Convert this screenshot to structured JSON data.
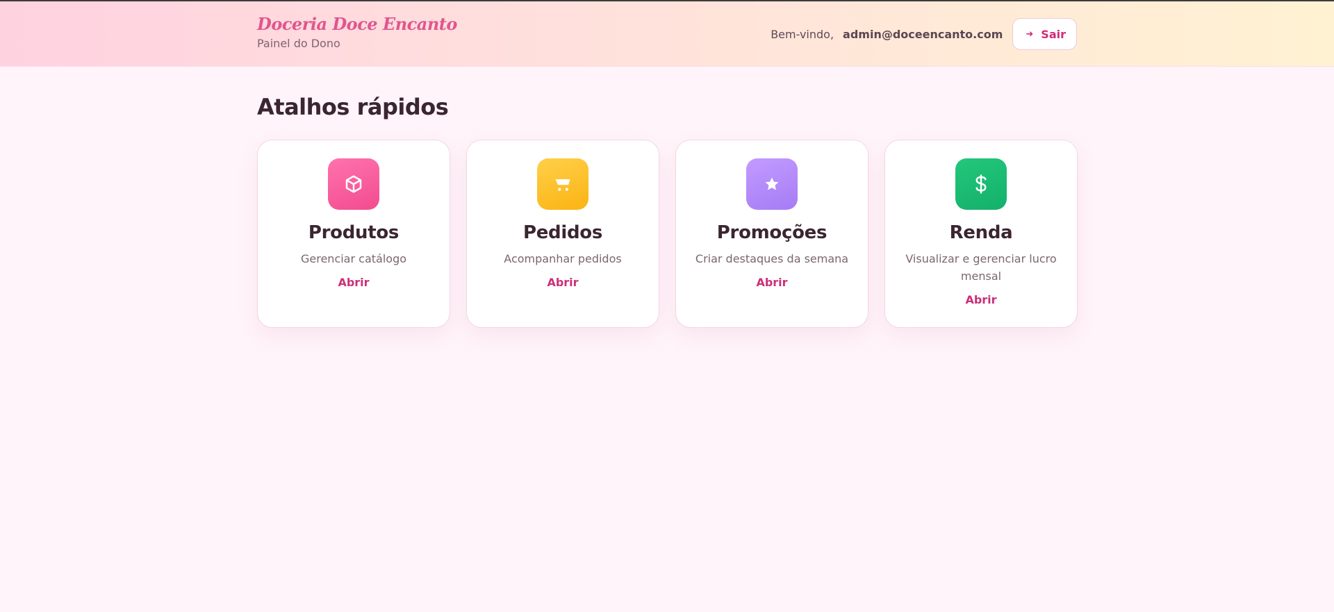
{
  "header": {
    "brand_name": "Doceria Doce Encanto",
    "brand_subtitle": "Painel do Dono",
    "welcome_text": "Bem-vindo,",
    "user_email": "admin@doceencanto.com",
    "logout_label": "Sair",
    "logout_icon": "arrow-right-icon"
  },
  "main": {
    "section_title": "Atalhos rápidos",
    "cards": [
      {
        "title": "Produtos",
        "description": "Gerenciar catálogo",
        "link_label": "Abrir",
        "icon": "box-icon",
        "color": "#f24c8f"
      },
      {
        "title": "Pedidos",
        "description": "Acompanhar pedidos",
        "link_label": "Abrir",
        "icon": "cart-icon",
        "color": "#fbb312"
      },
      {
        "title": "Promoções",
        "description": "Criar destaques da semana",
        "link_label": "Abrir",
        "icon": "star-icon",
        "color": "#a57cf5"
      },
      {
        "title": "Renda",
        "description": "Visualizar e gerenciar lucro mensal",
        "link_label": "Abrir",
        "icon": "dollar-icon",
        "color": "#14b06a"
      }
    ]
  },
  "colors": {
    "accent": "#cc2f78",
    "brand": "#e0568e",
    "background": "#fff4fa"
  }
}
